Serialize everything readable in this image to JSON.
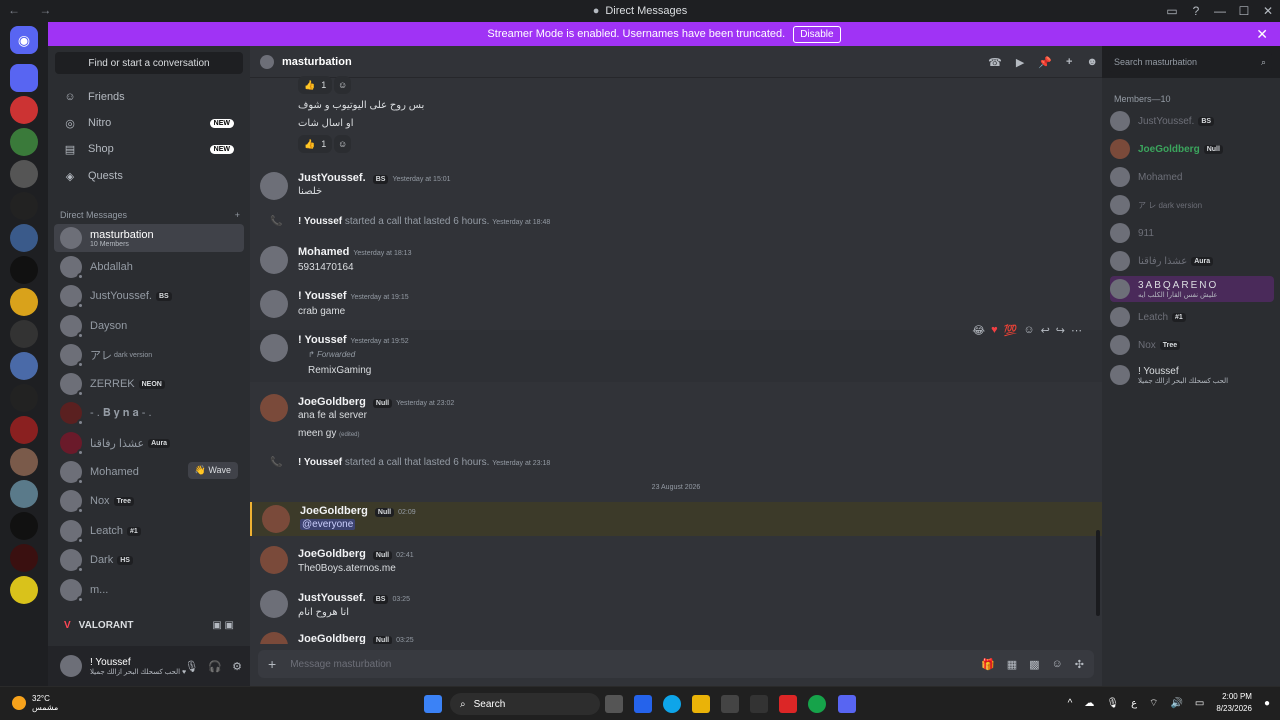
{
  "window": {
    "title": "Direct Messages"
  },
  "banner": {
    "text": "Streamer Mode is enabled. Usernames have been truncated.",
    "button": "Disable"
  },
  "sidebar": {
    "find_placeholder": "Find or start a conversation",
    "nav": [
      {
        "label": "Friends",
        "icon": "friends-icon"
      },
      {
        "label": "Nitro",
        "icon": "nitro-icon",
        "badge": "NEW"
      },
      {
        "label": "Shop",
        "icon": "shop-icon",
        "badge": "NEW"
      },
      {
        "label": "Quests",
        "icon": "quests-icon"
      }
    ],
    "dm_header": "Direct Messages",
    "dms": [
      {
        "name": "masturbation",
        "sub": "10 Members",
        "selected": true
      },
      {
        "name": "Abdallah"
      },
      {
        "name": "JustYoussef.",
        "tag": "BS"
      },
      {
        "name": "Dayson"
      },
      {
        "name": "アレ",
        "sub": "dark version"
      },
      {
        "name": "ZERREK",
        "tag": "NEON"
      },
      {
        "name": "- . 𝐁 𝐲 𝐧 𝐚 - ."
      },
      {
        "name": "عشذا رفاقنا",
        "tag": "Aura"
      },
      {
        "name": "Mohamed",
        "wave": "Wave"
      },
      {
        "name": "Nox",
        "tag": "Tree"
      },
      {
        "name": "Leatch",
        "tag": "#1"
      },
      {
        "name": "Dark",
        "tag": "HS"
      },
      {
        "name": "m..."
      }
    ],
    "activity": "VALORANT",
    "user": {
      "name": "! Youssef",
      "status": "الحب كسحلك البحر ازالك جميلا ♥"
    }
  },
  "chat": {
    "channel": "masturbation",
    "search_placeholder": "Search masturbation",
    "composer_placeholder": "Message masturbation",
    "messages": [
      {
        "kind": "react",
        "count": "1"
      },
      {
        "kind": "text",
        "text": "بس روح على اليوتيوب و شوف"
      },
      {
        "kind": "text2",
        "text": "او اسال شات"
      },
      {
        "kind": "react2",
        "count": "1"
      },
      {
        "author": "JustYoussef.",
        "tag": "BS",
        "time": "Yesterday at 15:01",
        "text": "خلصنا"
      },
      {
        "system": "! Youssef",
        "action": "started a call that lasted 6 hours.",
        "time": "Yesterday at 18:48"
      },
      {
        "author": "Mohamed",
        "time": "Yesterday at 18:13",
        "text": "5931470164"
      },
      {
        "author": "! Youssef",
        "time": "Yesterday at 19:15",
        "text": "crab game"
      },
      {
        "author": "! Youssef",
        "time": "Yesterday at 19:52",
        "forwarded": "Forwarded",
        "text": "RemixGaming"
      },
      {
        "author": "JoeGoldberg",
        "tag": "Null",
        "time": "Yesterday at 23:02",
        "text": "ana fe al server",
        "text2": "meen gy",
        "edited": "(edited)"
      },
      {
        "system": "! Youssef",
        "action": "started a call that lasted 6 hours.",
        "time": "Yesterday at 23:18"
      },
      {
        "divider": "23 August 2026"
      },
      {
        "author": "JoeGoldberg",
        "tag": "Null",
        "time": "02:09",
        "text": "@everyone"
      },
      {
        "author": "JoeGoldberg",
        "tag": "Null",
        "time": "02:41",
        "text": "The0Boys.aternos.me"
      },
      {
        "author": "JustYoussef.",
        "tag": "BS",
        "time": "03:25",
        "text": "انا هروح انام"
      },
      {
        "author": "JoeGoldberg",
        "tag": "Null",
        "time": "03:25"
      }
    ]
  },
  "members": {
    "header": "Members—10",
    "list": [
      {
        "name": "JustYoussef.",
        "tag": "BS"
      },
      {
        "name": "JoeGoldberg",
        "tag": "Null",
        "active": true
      },
      {
        "name": "Mohamed"
      },
      {
        "name": "ア レ dark version"
      },
      {
        "name": "911"
      },
      {
        "name": "عشذا رفاقنا",
        "tag": "Aura"
      },
      {
        "name": "3ABQARENO",
        "status": "عليش نفس القارا الكلب ايه",
        "active": true
      },
      {
        "name": "Leatch",
        "tag": "#1"
      },
      {
        "name": "Nox",
        "tag": "Tree"
      },
      {
        "name": "! Youssef",
        "status": "الحب كسحلك البحر ازالك جميلا",
        "active": true
      }
    ]
  },
  "taskbar": {
    "temp": "32°C",
    "weather": "مشمس",
    "search": "Search",
    "time": "2:00 PM",
    "date": "8/23/2026",
    "lang": "ع"
  }
}
